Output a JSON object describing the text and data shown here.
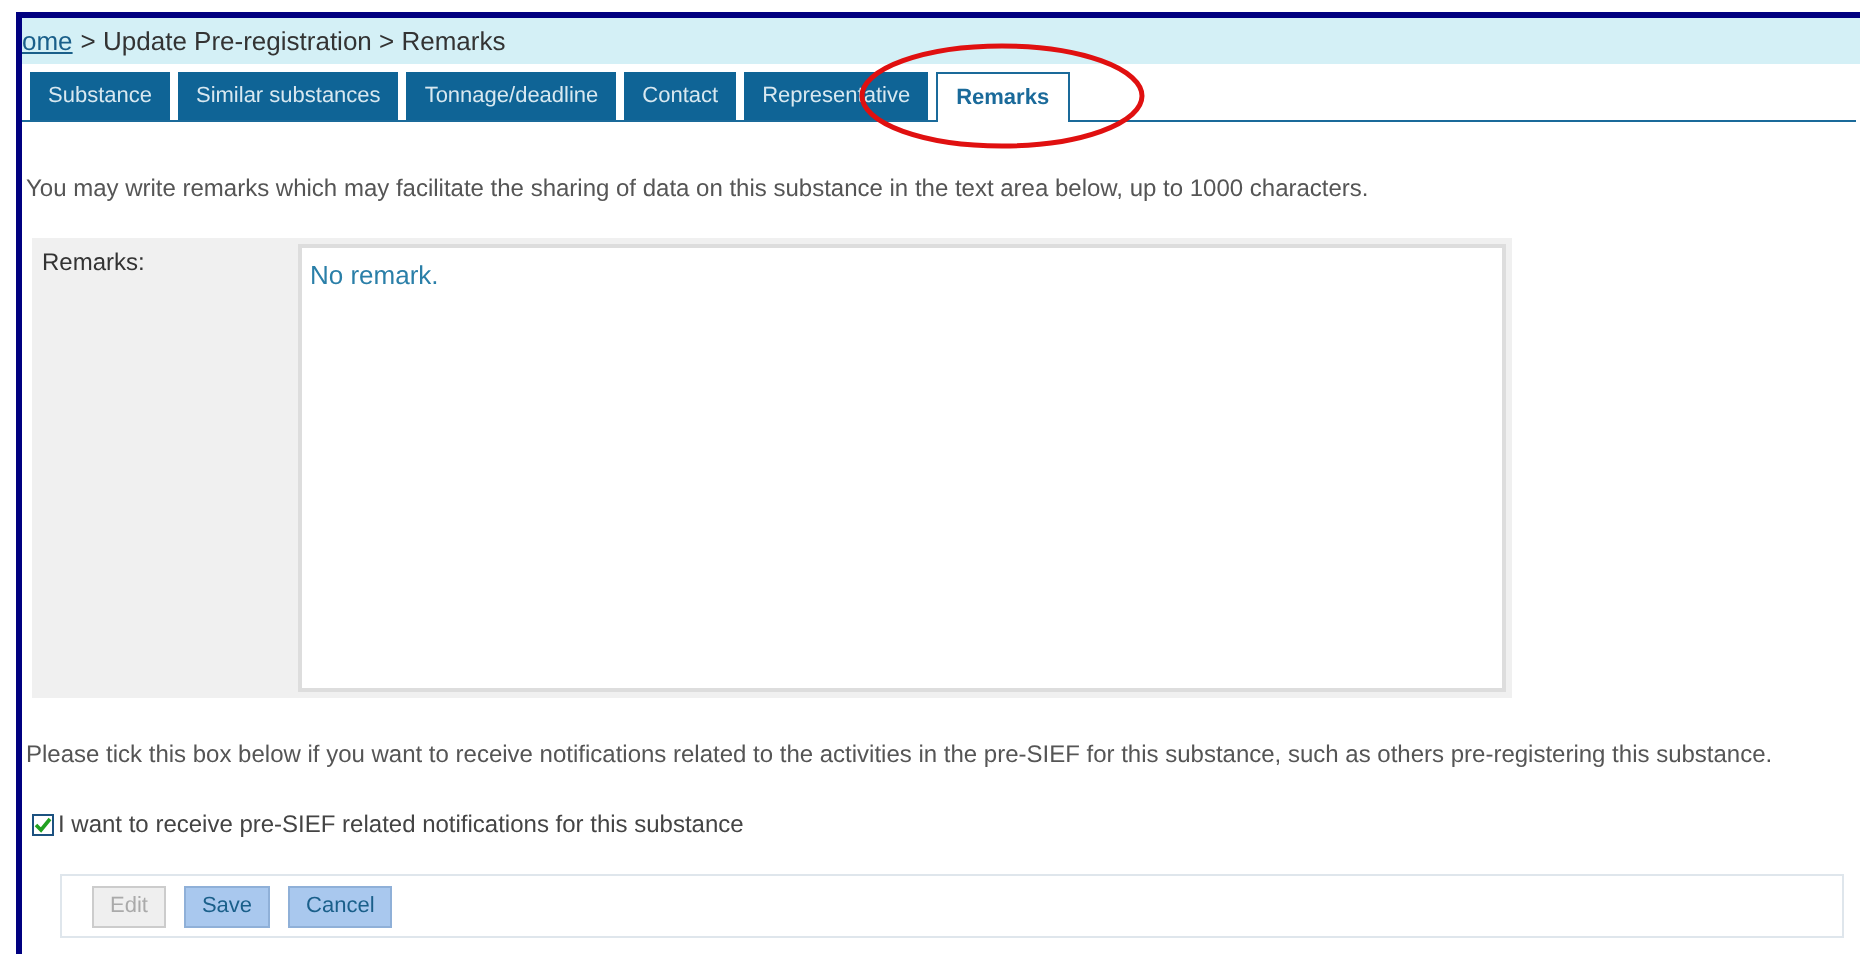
{
  "breadcrumb": [
    {
      "label": "ome",
      "kind": "link"
    },
    {
      "label": "> Update Pre-registration > Remarks",
      "kind": "text"
    }
  ],
  "tabs": [
    {
      "label": "Substance",
      "selected": false,
      "highlighted": false
    },
    {
      "label": "Similar substances",
      "selected": false,
      "highlighted": false
    },
    {
      "label": "Tonnage/deadline",
      "selected": false,
      "highlighted": false
    },
    {
      "label": "Contact",
      "selected": false,
      "highlighted": false
    },
    {
      "label": "Representative",
      "selected": false,
      "highlighted": false
    },
    {
      "label": "Remarks",
      "selected": true,
      "highlighted": true
    }
  ],
  "intro": "You may write remarks which may facilitate the sharing of data on this substance in the text area below, up to 1000 characters.",
  "remarks": {
    "label": "Remarks:",
    "value": "No remark."
  },
  "notification_text": "Please tick this box below if you want to receive notifications related to the activities in the pre-SIEF for this substance, such as others pre-registering this substance.",
  "notification_checkbox": {
    "label": "I want to receive pre-SIEF related notifications for this substance",
    "checked": true
  },
  "buttons": [
    {
      "label": "Edit",
      "disabled": true
    },
    {
      "label": "Save",
      "disabled": false
    },
    {
      "label": "Cancel",
      "disabled": false
    }
  ]
}
